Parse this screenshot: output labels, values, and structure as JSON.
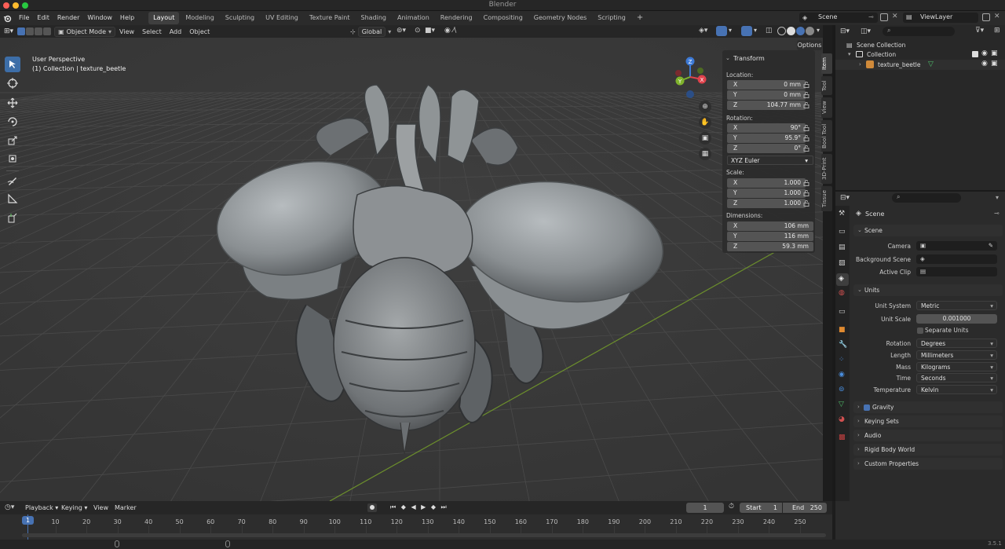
{
  "window": {
    "title": "Blender"
  },
  "menu": [
    "File",
    "Edit",
    "Render",
    "Window",
    "Help"
  ],
  "workspaces": [
    {
      "label": "Layout",
      "active": true
    },
    {
      "label": "Modeling"
    },
    {
      "label": "Sculpting"
    },
    {
      "label": "UV Editing"
    },
    {
      "label": "Texture Paint"
    },
    {
      "label": "Shading"
    },
    {
      "label": "Animation"
    },
    {
      "label": "Rendering"
    },
    {
      "label": "Compositing"
    },
    {
      "label": "Geometry Nodes"
    },
    {
      "label": "Scripting"
    }
  ],
  "top_right": {
    "scene": "Scene",
    "view_layer": "ViewLayer"
  },
  "viewport_header": {
    "mode": "Object Mode",
    "menus": [
      "View",
      "Select",
      "Add",
      "Object"
    ],
    "orientation": "Global",
    "options": "Options"
  },
  "viewport": {
    "view_name": "User Perspective",
    "collection_info": "(1) Collection | texture_beetle",
    "gizmo": {
      "x": "X",
      "y": "Y",
      "z": "Z"
    }
  },
  "transform_panel": {
    "title": "Transform",
    "location_label": "Location:",
    "location": [
      {
        "axis": "X",
        "value": "0 mm"
      },
      {
        "axis": "Y",
        "value": "0 mm"
      },
      {
        "axis": "Z",
        "value": "104.77 mm"
      }
    ],
    "rotation_label": "Rotation:",
    "rotation": [
      {
        "axis": "X",
        "value": "90°"
      },
      {
        "axis": "Y",
        "value": "95.9°"
      },
      {
        "axis": "Z",
        "value": "0°"
      }
    ],
    "rotation_mode": "XYZ Euler",
    "scale_label": "Scale:",
    "scale": [
      {
        "axis": "X",
        "value": "1.000"
      },
      {
        "axis": "Y",
        "value": "1.000"
      },
      {
        "axis": "Z",
        "value": "1.000"
      }
    ],
    "dimensions_label": "Dimensions:",
    "dimensions": [
      {
        "axis": "X",
        "value": "106 mm"
      },
      {
        "axis": "Y",
        "value": "116 mm"
      },
      {
        "axis": "Z",
        "value": "59.3 mm"
      }
    ]
  },
  "side_tabs": [
    "Item",
    "Tool",
    "View",
    "Bool Tool",
    "3D-Print",
    "Tissue"
  ],
  "outliner": {
    "root": "Scene Collection",
    "collection": "Collection",
    "object": "texture_beetle"
  },
  "properties": {
    "context": "Scene",
    "scene_section": "Scene",
    "camera_label": "Camera",
    "background_scene_label": "Background Scene",
    "active_clip_label": "Active Clip",
    "units_section": "Units",
    "unit_system_label": "Unit System",
    "unit_system": "Metric",
    "unit_scale_label": "Unit Scale",
    "unit_scale": "0.001000",
    "separate_units": "Separate Units",
    "rotation_label": "Rotation",
    "rotation": "Degrees",
    "length_label": "Length",
    "length": "Millimeters",
    "mass_label": "Mass",
    "mass": "Kilograms",
    "time_label": "Time",
    "time": "Seconds",
    "temperature_label": "Temperature",
    "temperature": "Kelvin",
    "sections": [
      "Gravity",
      "Keying Sets",
      "Audio",
      "Rigid Body World",
      "Custom Properties"
    ]
  },
  "timeline": {
    "menus": [
      "Playback",
      "Keying",
      "View",
      "Marker"
    ],
    "current_frame": "1",
    "start_label": "Start",
    "start": "1",
    "end_label": "End",
    "end": "250",
    "ticks": [
      "1",
      "10",
      "20",
      "30",
      "40",
      "50",
      "60",
      "70",
      "80",
      "90",
      "100",
      "110",
      "120",
      "130",
      "140",
      "150",
      "160",
      "170",
      "180",
      "190",
      "200",
      "210",
      "220",
      "230",
      "240",
      "250"
    ]
  },
  "status": {
    "version": "3.5.1"
  }
}
